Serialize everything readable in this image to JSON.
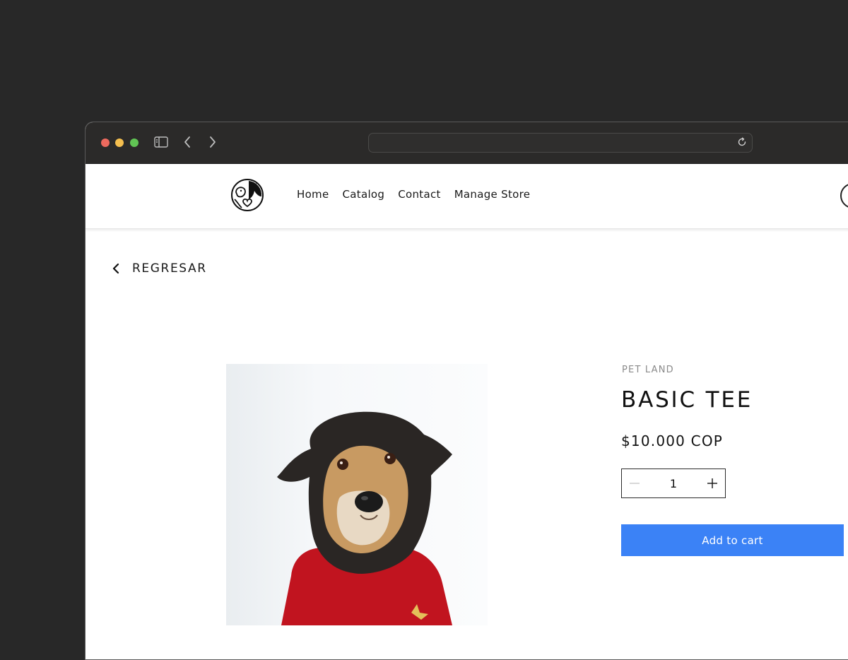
{
  "browser": {
    "address_value": "",
    "icons": [
      "sidebar-icon",
      "chevron-left-icon",
      "chevron-right-icon",
      "reload-icon"
    ],
    "traffic_lights": {
      "close": "#ed6a5e",
      "minimize": "#f4bf4f",
      "zoom": "#61c554"
    }
  },
  "header": {
    "nav": [
      {
        "label": "Home"
      },
      {
        "label": "Catalog"
      },
      {
        "label": "Contact"
      },
      {
        "label": "Manage Store"
      }
    ]
  },
  "back_link": {
    "label": "REGRESAR",
    "icon": "chevron-left-icon"
  },
  "product": {
    "image_subject": "dog-in-red-sweater",
    "vendor": "PET LAND",
    "title": "BASIC TEE",
    "price": "$10.000 COP",
    "quantity": "1",
    "add_to_cart_label": "Add to cart"
  },
  "colors": {
    "accent": "#3b82f6",
    "page_background": "#282828",
    "titlebar": "#2b2a29"
  }
}
